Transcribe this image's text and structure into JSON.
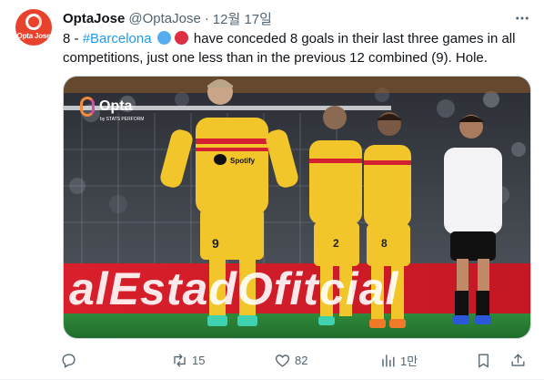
{
  "author": {
    "display_name": "OptaJose",
    "handle": "@OptaJose",
    "avatar_text": "Opta Jose"
  },
  "separator": "·",
  "timestamp": "12월 17일",
  "tweet": {
    "text_prefix": "8 - ",
    "hashtag": "#Barcelona",
    "emoji_colors": [
      "#55acee",
      "#dd2e44"
    ],
    "text_line1_rest": " have conceded 8 goals in their last three games in all",
    "text_line2": "competitions, just one less than in the previous 12 combined (9). Hole."
  },
  "media": {
    "logo_text": "Opta",
    "logo_subtext": "by STATS PERFORM",
    "board_text": "alEstadOfitcial",
    "jersey_sponsor": "Spotify",
    "player_numbers": [
      "9",
      "2",
      "8"
    ]
  },
  "actions": {
    "reply_count": "",
    "retweet_count": "15",
    "like_count": "82",
    "views_count": "1만"
  },
  "colors": {
    "link": "#1d9bf0",
    "muted": "#536471",
    "avatar_bg": "#e8412c"
  }
}
